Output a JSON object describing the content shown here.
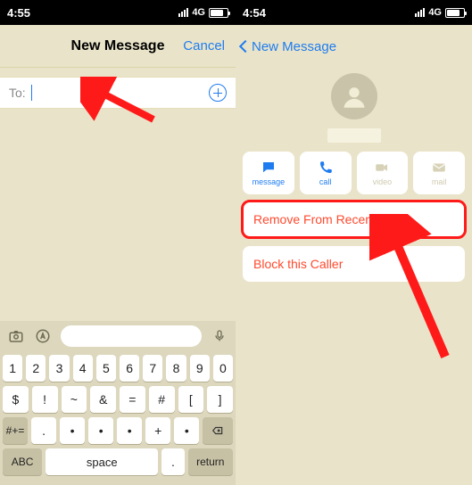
{
  "left": {
    "status": {
      "time": "4:55",
      "net": "4G"
    },
    "nav": {
      "title": "New Message",
      "cancel": "Cancel"
    },
    "to": {
      "label": "To:",
      "value": ""
    },
    "keyboard": {
      "row1": [
        "1",
        "2",
        "3",
        "4",
        "5",
        "6",
        "7",
        "8",
        "9",
        "0"
      ],
      "row2": [
        "$",
        "!",
        "~",
        "&",
        "=",
        "#",
        "[",
        "]"
      ],
      "row3": [
        "_",
        "•",
        "•",
        "•",
        "+",
        "•"
      ],
      "hash": "#+=",
      "punct1": ".",
      "punct2": ",",
      "abc": "ABC",
      "space": "space",
      "ret": "return"
    }
  },
  "right": {
    "status": {
      "time": "4:54",
      "net": "4G"
    },
    "nav": {
      "back": "New Message"
    },
    "actions": {
      "message": "message",
      "call": "call",
      "video": "video",
      "mail": "mail"
    },
    "list": {
      "remove": "Remove From Recents",
      "block": "Block this Caller"
    }
  }
}
